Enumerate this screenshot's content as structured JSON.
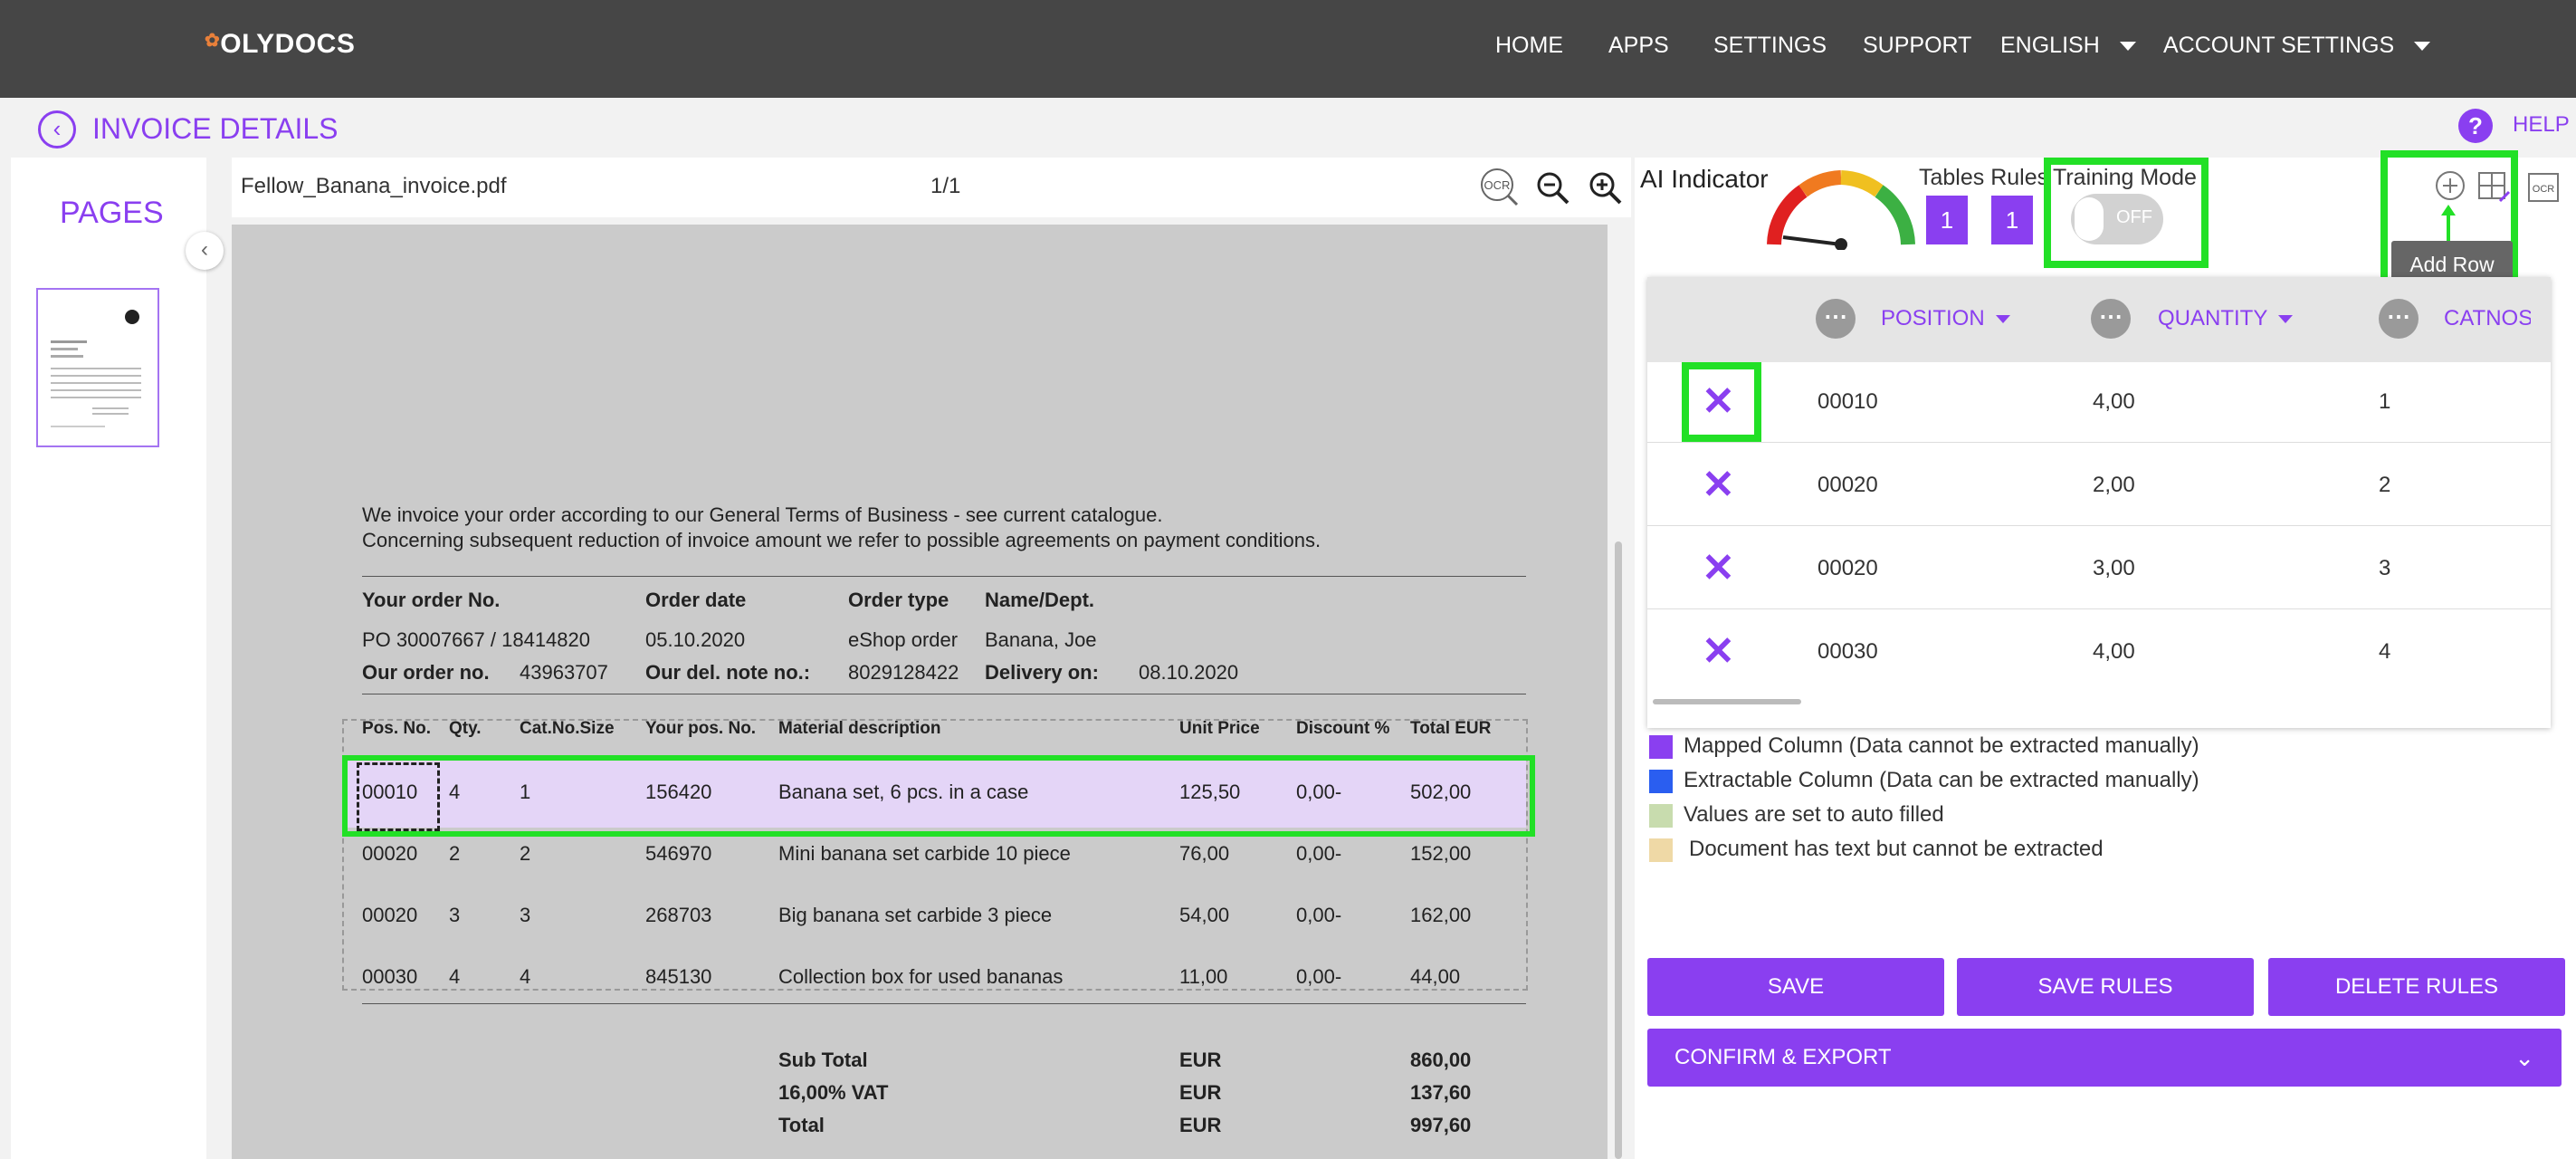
{
  "header": {
    "logo": "OLYDOCS",
    "nav": [
      "HOME",
      "APPS",
      "SETTINGS",
      "SUPPORT"
    ],
    "language": "ENGLISH",
    "account": "ACCOUNT SETTINGS"
  },
  "titlebar": {
    "title": "INVOICE DETAILS",
    "help": "HELP"
  },
  "pages": {
    "title": "PAGES"
  },
  "viewer": {
    "filename": "Fellow_Banana_invoice.pdf",
    "page_indicator": "1/1",
    "ocr_label": "OCR"
  },
  "document": {
    "intro1": "We invoice your order according to our General Terms of Business - see current catalogue.",
    "intro2": "Concerning subsequent reduction of invoice amount we refer to possible agreements on payment conditions.",
    "order_headers": {
      "order_no": "Your order No.",
      "order_date": "Order date",
      "order_type": "Order type",
      "name_dept": "Name/Dept."
    },
    "order_values": {
      "order_no": "PO 30007667 / 18414820",
      "order_date": "05.10.2020",
      "order_type": "eShop order",
      "name_dept": "Banana, Joe"
    },
    "our_order_label": "Our order no.",
    "our_order_value": "43963707",
    "del_note_label": "Our del. note no.:",
    "del_note_value": "8029128422",
    "delivery_label": "Delivery on:",
    "delivery_value": "08.10.2020",
    "table_headers": [
      "Pos. No.",
      "Qty.",
      "Cat.No.Size",
      "Your pos. No.",
      "Material description",
      "Unit Price",
      "Discount %",
      "Total EUR"
    ],
    "rows": [
      [
        "00010",
        "4",
        "1",
        "156420",
        "Banana set, 6 pcs. in a case",
        "125,50",
        "0,00-",
        "502,00"
      ],
      [
        "00020",
        "2",
        "2",
        "546970",
        "Mini banana set carbide 10 piece",
        "76,00",
        "0,00-",
        "152,00"
      ],
      [
        "00020",
        "3",
        "3",
        "268703",
        "Big banana set carbide 3 piece",
        "54,00",
        "0,00-",
        "162,00"
      ],
      [
        "00030",
        "4",
        "4",
        "845130",
        "Collection box for used bananas",
        "11,00",
        "0,00-",
        "44,00"
      ]
    ],
    "totals": [
      [
        "Sub Total",
        "EUR",
        "860,00"
      ],
      [
        "16,00% VAT",
        "EUR",
        "137,60"
      ],
      [
        "Total",
        "EUR",
        "997,60"
      ]
    ]
  },
  "right": {
    "ai_indicator": "AI Indicator",
    "tables_label": "Tables",
    "rules_label": "Rules",
    "tables_count": "1",
    "rules_count": "1",
    "training_mode": "Training Mode",
    "toggle_state": "OFF",
    "add_row_tooltip": "Add Row",
    "ocr_icon_label": "OCR",
    "columns": [
      "POSITION",
      "QUANTITY",
      "CATNOSI"
    ],
    "rows": [
      [
        "00010",
        "4,00",
        "1"
      ],
      [
        "00020",
        "2,00",
        "2"
      ],
      [
        "00020",
        "3,00",
        "3"
      ],
      [
        "00030",
        "4,00",
        "4"
      ]
    ],
    "legend": [
      {
        "color": "#8a3ff0",
        "text": "Mapped Column (Data cannot be extracted manually)"
      },
      {
        "color": "#2a5ef0",
        "text": "Extractable Column (Data can be extracted manually)"
      },
      {
        "color": "#c8dcae",
        "text": "Values are set to auto filled"
      },
      {
        "color": "#efd9a6",
        "text": "Document has text but cannot be extracted"
      }
    ],
    "buttons": {
      "save": "SAVE",
      "save_rules": "SAVE RULES",
      "delete_rules": "DELETE RULES",
      "confirm": "CONFIRM & EXPORT"
    },
    "delete_symbol": "✕"
  },
  "colors": {
    "accent": "#8a3ff0",
    "highlight": "#22e026",
    "topbar": "#464646"
  }
}
